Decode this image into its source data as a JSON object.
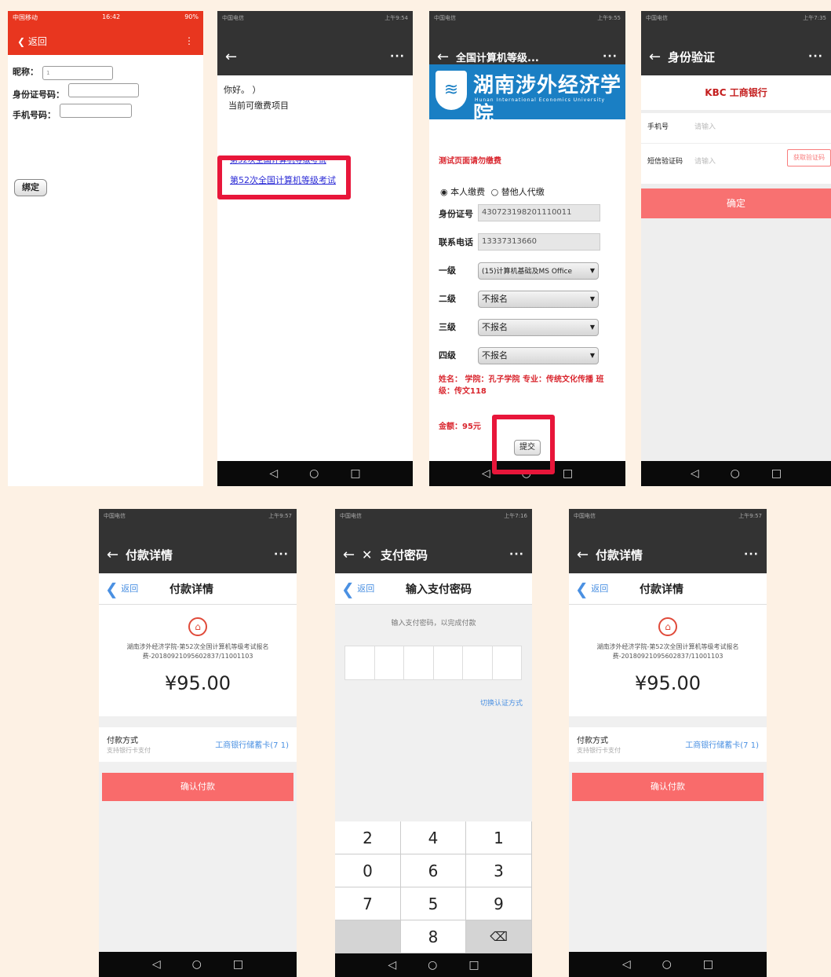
{
  "s1": {
    "status": {
      "left": "中国移动",
      "time": "16:42",
      "right": "90%"
    },
    "title": "返回",
    "nickname_label": "昵称：",
    "nickname_value": "1",
    "id_label": "身份证号码：",
    "phone_label": "手机号码：",
    "bind_button": "绑定"
  },
  "s2": {
    "status": {
      "left": "中国电信",
      "right": "上午9:54"
    },
    "greeting": "你好。 ）",
    "section": "当前可缴费项目",
    "link_cut": "第52次全国计算机等级考试",
    "link": "第52次全国计算机等级考试"
  },
  "s3": {
    "status": {
      "left": "中国电信",
      "right": "上午9:55"
    },
    "title": "全国计算机等级...",
    "banner_cn": "湖南涉外经济学院",
    "banner_en": "Hunan International Economics University",
    "page_title": "测试页面请勿缴费",
    "radio1": "本人缴费",
    "radio2": "替他人代缴",
    "id_label": "身份证号",
    "id_value": "430723198201110011",
    "phone_label": "联系电话",
    "phone_value": "13337313660",
    "levels": [
      {
        "label": "一级",
        "value": "(15)计算机基础及MS Office"
      },
      {
        "label": "二级",
        "value": "不报名"
      },
      {
        "label": "三级",
        "value": "不报名"
      },
      {
        "label": "四级",
        "value": "不报名"
      }
    ],
    "info": "姓名： 学院：孔子学院 专业：传统文化传播 班级：传文118",
    "amount": "金额：95元",
    "submit": "提交"
  },
  "s4": {
    "status": {
      "left": "中国电信",
      "right": "上午7:35"
    },
    "title": "身份验证",
    "bank": "KBC 工商银行",
    "phone_label": "手机号",
    "phone_ph": "请输入",
    "code_label": "短信验证码",
    "code_ph": "请输入",
    "code_btn": "获取验证码",
    "confirm": "确定"
  },
  "s5": {
    "status": {
      "left": "中国电信",
      "right": "上午9:57"
    },
    "title": "付款详情",
    "back": "返回",
    "header": "付款详情",
    "desc": "湖南涉外经济学院-第52次全国计算机等级考试报名费-20180921095602837/11001103",
    "amount": "¥95.00",
    "method_label": "付款方式",
    "method_sub": "支持银行卡支付",
    "method_value": "工商银行储蓄卡(7  1)",
    "confirm": "确认付款"
  },
  "s6": {
    "status": {
      "left": "中国电信",
      "right": "上午7:16"
    },
    "title": "支付密码",
    "back": "返回",
    "header": "输入支付密码",
    "hint": "输入支付密码，以完成付款",
    "switch": "切换认证方式",
    "keys": [
      "2",
      "4",
      "1",
      "0",
      "6",
      "3",
      "7",
      "5",
      "9",
      "8",
      "⌫"
    ]
  },
  "s7": {
    "status": {
      "left": "中国电信",
      "right": "上午9:57"
    },
    "title": "付款详情",
    "back": "返回",
    "header": "付款详情",
    "desc": "湖南涉外经济学院-第52次全国计算机等级考试报名费-20180921095602837/11001103",
    "amount": "¥95.00",
    "method_label": "付款方式",
    "method_sub": "支持银行卡支付",
    "method_value": "工商银行储蓄卡(7  1)",
    "confirm": "确认付款"
  }
}
